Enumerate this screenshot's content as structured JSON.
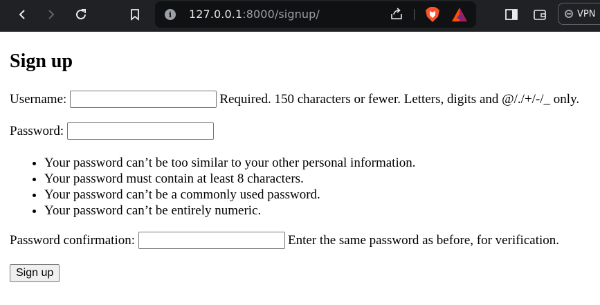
{
  "browser": {
    "url_host": "127.0.0.1",
    "url_path": ":8000/signup/",
    "vpn_label": "VPN",
    "colors": {
      "toolbar_bg": "#202124",
      "omnibox_bg": "#101113",
      "icon": "#9aa0a6"
    },
    "icons": [
      "back-icon",
      "forward-icon",
      "reload-icon",
      "bookmark-icon",
      "site-info-icon",
      "share-icon",
      "brave-shields-icon",
      "brave-rewards-icon",
      "sidebar-icon",
      "wallet-icon",
      "vpn-icon"
    ]
  },
  "form": {
    "title": "Sign up",
    "username_label": "Username:",
    "username_value": "",
    "username_help": "Required. 150 characters or fewer. Letters, digits and @/./+/-/_ only.",
    "password_label": "Password:",
    "password_value": "",
    "password_help": [
      "Your password can’t be too similar to your other personal information.",
      "Your password must contain at least 8 characters.",
      "Your password can’t be a commonly used password.",
      "Your password can’t be entirely numeric."
    ],
    "confirm_label": "Password confirmation:",
    "confirm_value": "",
    "confirm_help": "Enter the same password as before, for verification.",
    "submit_label": "Sign up"
  }
}
